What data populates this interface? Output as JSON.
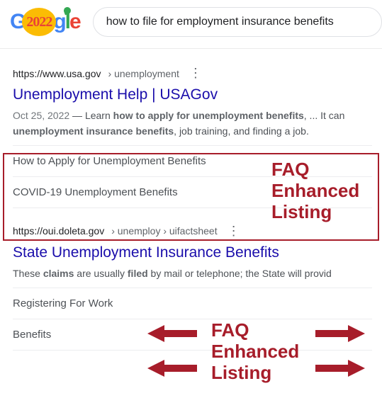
{
  "logo": {
    "mid_text": "2022"
  },
  "search": {
    "query": "how to file for employment insurance benefits"
  },
  "result1": {
    "domain": "https://www.usa.gov",
    "path": " › unemployment",
    "title": "Unemployment Help | USAGov",
    "date": "Oct 25, 2022",
    "snip_plain1": " — Learn ",
    "snip_b1": "how to apply for unemployment benefits",
    "snip_plain2": ", ... It can ",
    "snip_b2": "unemployment insurance benefits",
    "snip_plain3": ", job training, and finding a job.",
    "sitelinks": [
      "How to Apply for Unemployment Benefits",
      "COVID-19 Unemployment Benefits"
    ]
  },
  "result2": {
    "domain": "https://oui.doleta.gov",
    "path": " › unemploy › uifactsheet",
    "title": "State Unemployment Insurance Benefits",
    "snip_plain1": "These ",
    "snip_b1": "claims",
    "snip_plain2": " are usually ",
    "snip_b2": "filed",
    "snip_plain3": " by mail or telephone; the State will provid",
    "sitelinks": [
      "Registering For Work",
      "Benefits"
    ]
  },
  "annotation": {
    "label1_l1": "FAQ",
    "label1_l2": "Enhanced",
    "label1_l3": "Listing",
    "label2_l1": "FAQ",
    "label2_l2": "Enhanced",
    "label2_l3": "Listing"
  }
}
